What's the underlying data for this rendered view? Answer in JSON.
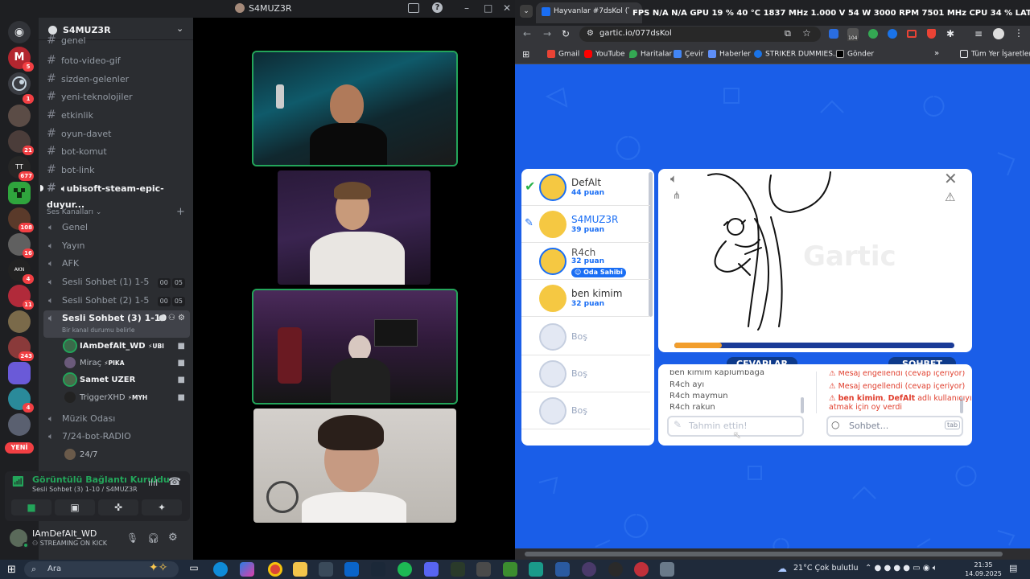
{
  "discord": {
    "window_title": "S4MUZ3R",
    "server_name": "S4MUZ3R",
    "text_channels": [
      "genel",
      "foto-video-gif",
      "sizden-gelenler",
      "yeni-teknolojiler",
      "etkinlik",
      "oyun-davet",
      "bot-komut",
      "bot-link",
      "ubisoft-steam-epic-duyur..."
    ],
    "voice_category": "Ses Kanalları",
    "voice_channels": [
      "Genel",
      "Yayın",
      "AFK"
    ],
    "voice_sesli1": "Sesli Sohbet (1) 1-5",
    "voice_sesli1_a": "00",
    "voice_sesli1_b": "05",
    "voice_sesli2": "Sesli Sohbet (2) 1-5",
    "voice_sesli2_a": "00",
    "voice_sesli2_b": "05",
    "active_voice": "Sesli Sohbet (3) 1-10",
    "active_voice_status": "Bir kanal durumu belirle",
    "voice_users": [
      {
        "name": "IAmDefAlt_WD",
        "tag": "UBI"
      },
      {
        "name": "Miraç",
        "tag": "PIKA"
      },
      {
        "name": "Samet UZER",
        "tag": ""
      },
      {
        "name": "TriggerXHD",
        "tag": "MYH"
      }
    ],
    "more_channels": [
      "Müzik Odası",
      "7/24-bot-RADIO"
    ],
    "radio_sub": "24/7",
    "guild_badges": [
      "5",
      "1",
      "21",
      "677",
      "108",
      "16",
      "4",
      "11",
      "243",
      "4"
    ],
    "new_badge": "YENİ",
    "connection_status": "Görüntülü Bağlantı Kuruldu",
    "connection_sub": "Sesli Sohbet (3) 1-10 / S4MUZ3R",
    "user_name": "IAmDefAlt_WD",
    "user_status": "STREAMING ON KICK"
  },
  "chrome": {
    "tab_title": "Hayvanlar #7dsKol (Türkçe)",
    "url": "gartic.io/077dsKol",
    "bookmarks": [
      "Gmail",
      "YouTube",
      "Haritalar",
      "Çevir",
      "Haberler",
      "STRIKER DUMMIES...",
      "Gönder"
    ],
    "all_bookmarks": "Tüm Yer İşaretleri",
    "ext_badge": "104",
    "osd": "FPS N/A  N/A    GPU 19 % 40 °C  1837 MHz  1.000 V  54 W  3000 RPM  7501 MHz    CPU 34 %    LAT N/A  N/A"
  },
  "gartic": {
    "players": [
      {
        "name": "DefAlt",
        "points": "44 puan",
        "state": "correct"
      },
      {
        "name": "S4MUZ3R",
        "points": "39 puan",
        "state": "drawing"
      },
      {
        "name": "R4ch",
        "points": "32 puan",
        "badge": "Oda Sahibi"
      },
      {
        "name": "ben kimim",
        "points": "32 puan"
      }
    ],
    "empty_slot": "Boş",
    "tab_answers": "CEVAPLAR",
    "tab_chat": "SOHBET",
    "answers": [
      {
        "user": "ben kimim",
        "text": "kaplumbağa"
      },
      {
        "user": "R4ch",
        "text": "ayı"
      },
      {
        "user": "R4ch",
        "text": "maymun"
      },
      {
        "user": "R4ch",
        "text": "rakun"
      }
    ],
    "chat": [
      {
        "text": "Mesaj engellendi (cevap içeriyor)"
      },
      {
        "text": "Mesaj engellendi (cevap içeriyor)"
      }
    ],
    "chat_vote_user": "ben kimim",
    "chat_vote_mid": ", ",
    "chat_vote_target": "DefAlt",
    "chat_vote_tail": " adlı kullanıcıyı",
    "chat_vote_line2": "atmak için oy verdi",
    "answer_placeholder": "Tahmin ettin!",
    "chat_placeholder": "Sohbet...",
    "chat_key": "tab",
    "progress": 0.17
  },
  "taskbar": {
    "search": "Ara",
    "weather": "21°C  Çok bulutlu",
    "time": "21:35",
    "date": "14.09.2025"
  }
}
